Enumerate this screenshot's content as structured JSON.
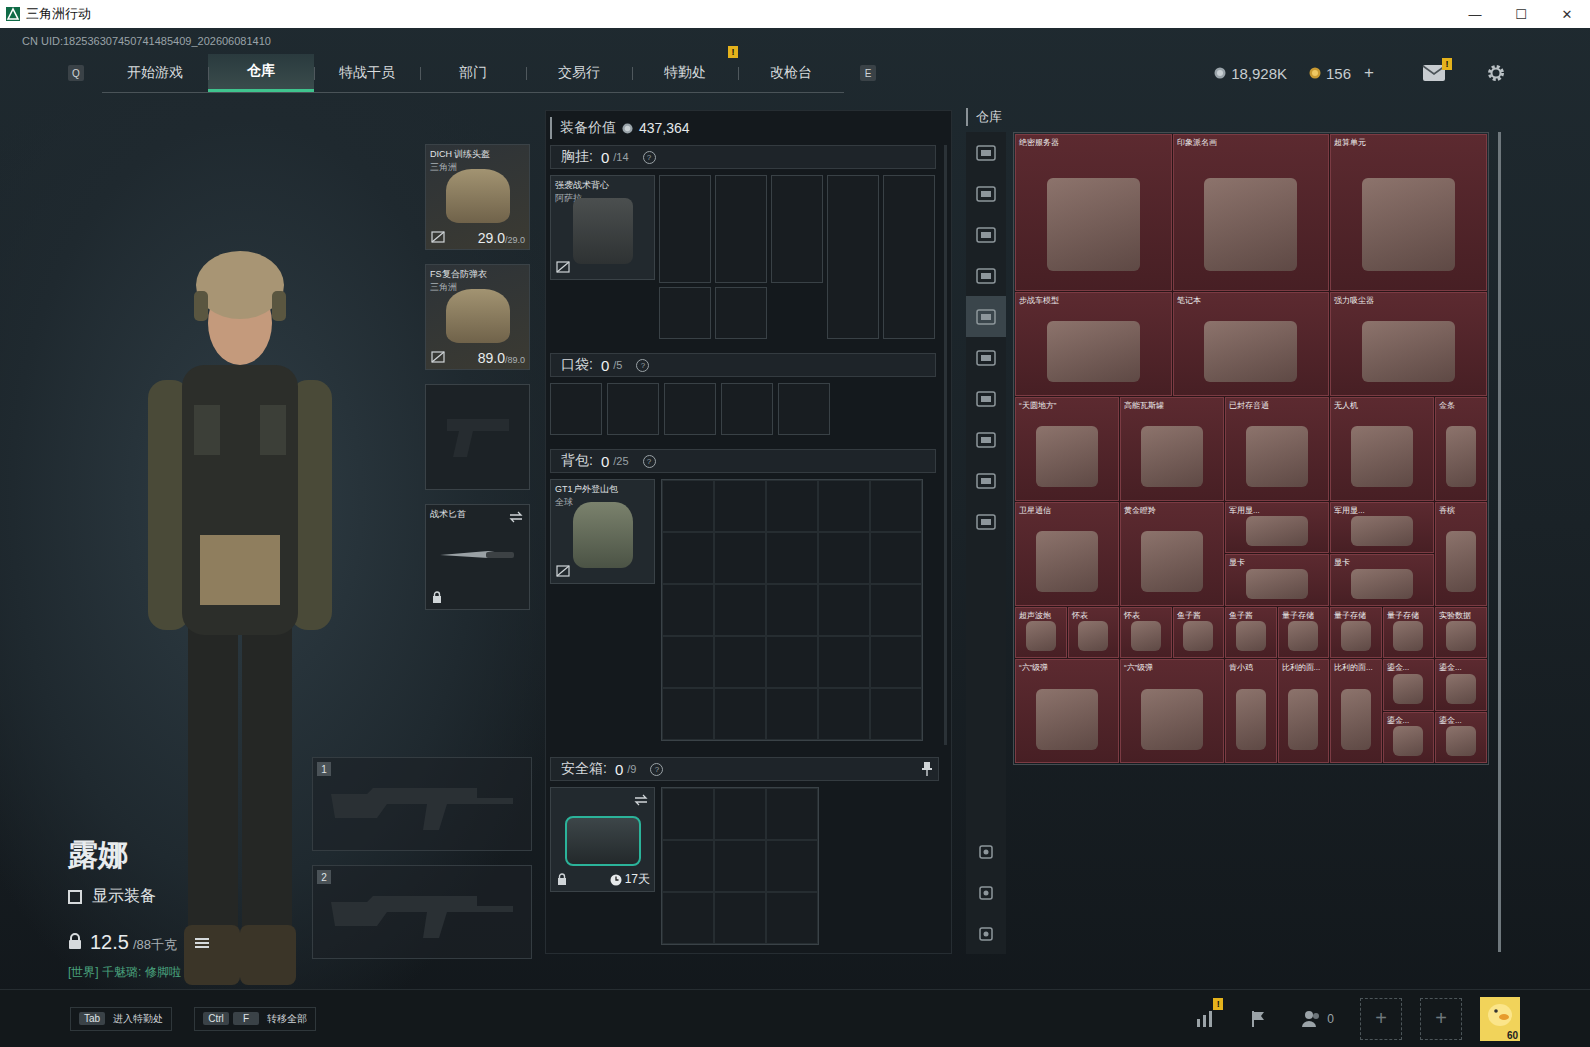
{
  "window": {
    "title": "三角洲行动",
    "controls": [
      "—",
      "☐",
      "✕"
    ]
  },
  "uid": "CN UID:182536307450741485409_202606081410",
  "nav": {
    "prev_key": "Q",
    "next_key": "E",
    "tabs": [
      {
        "label": "开始游戏",
        "selected": false,
        "badge": ""
      },
      {
        "label": "仓库",
        "selected": true,
        "badge": ""
      },
      {
        "label": "特战干员",
        "selected": false,
        "badge": ""
      },
      {
        "label": "部门",
        "selected": false,
        "badge": ""
      },
      {
        "label": "交易行",
        "selected": false,
        "badge": ""
      },
      {
        "label": "特勤处",
        "selected": false,
        "badge": "!"
      },
      {
        "label": "改枪台",
        "selected": false,
        "badge": ""
      }
    ]
  },
  "currency": {
    "money": "18,928K",
    "coupons": "156",
    "add": "+",
    "mail_badge": "!"
  },
  "character": {
    "name": "露娜",
    "show_gear": {
      "label": "显示装备",
      "checked": false
    },
    "weight": "12.5",
    "weight_max": "/88千克",
    "chat": "[世界] 千魅璐: 修脚啦"
  },
  "gear_slots": [
    {
      "kind": "equipped",
      "name": "DICH 训练头盔",
      "sub": "三角洲",
      "durability": "29.0",
      "max": "/29.0",
      "insured": false,
      "locked": false,
      "swappable": false
    },
    {
      "kind": "equipped",
      "name": "FS复合防弹衣",
      "sub": "三角洲",
      "durability": "89.0",
      "max": "/89.0",
      "insured": false,
      "locked": false,
      "swappable": false
    },
    {
      "kind": "empty",
      "name": "",
      "sub": "",
      "durability": "",
      "max": "",
      "insured": true,
      "locked": false,
      "swappable": false
    },
    {
      "kind": "melee",
      "name": "战术匕首",
      "sub": "",
      "durability": "",
      "max": "",
      "insured": true,
      "locked": true,
      "swappable": true
    }
  ],
  "weapon_slots": [
    {
      "number": "1"
    },
    {
      "number": "2"
    }
  ],
  "loadout": {
    "value_label": "装备价值",
    "value": "437,364",
    "chest": {
      "title": "胸挂:",
      "count": "0",
      "cap": "/14",
      "help": "?",
      "item": {
        "name": "强袭战术背心",
        "sub": "阿萨拉",
        "insured": false
      }
    },
    "pockets": {
      "title": "口袋:",
      "count": "0",
      "cap": "/5",
      "help": "?"
    },
    "backpack": {
      "title": "背包:",
      "count": "0",
      "cap": "/25",
      "help": "?",
      "item": {
        "name": "GT1户外登山包",
        "sub": "全球",
        "insured": false
      }
    },
    "safe_box": {
      "title": "安全箱:",
      "count": "0",
      "cap": "/9",
      "help": "?",
      "item": {
        "timer": "17天",
        "locked": true,
        "swappable": true
      }
    }
  },
  "warehouse": {
    "title": "仓库",
    "nav_top": [
      {
        "selected": false
      },
      {
        "selected": false
      },
      {
        "selected": false
      },
      {
        "selected": false
      },
      {
        "selected": true
      },
      {
        "selected": false
      },
      {
        "selected": false
      },
      {
        "selected": false
      },
      {
        "selected": false
      },
      {
        "selected": false
      }
    ],
    "nav_bottom": [
      {
        "selected": false
      },
      {
        "selected": false
      },
      {
        "selected": false
      }
    ],
    "items": [
      {
        "name": "绝密服务器"
      },
      {
        "name": "印象派名画"
      },
      {
        "name": "超算单元"
      },
      {
        "name": "步战车模型"
      },
      {
        "name": "笔记本"
      },
      {
        "name": "强力吸尘器"
      },
      {
        "name": "“天圆地方”"
      },
      {
        "name": "高能瓦斯罐"
      },
      {
        "name": "已封存音通"
      },
      {
        "name": "无人机"
      },
      {
        "name": "金条"
      },
      {
        "name": "卫星通信"
      },
      {
        "name": "黄金瞪羚"
      },
      {
        "name": "军用显..."
      },
      {
        "name": "军用显..."
      },
      {
        "name": "香槟"
      },
      {
        "name": "显卡"
      },
      {
        "name": "显卡"
      },
      {
        "name": "超声波炮"
      },
      {
        "name": "怀表"
      },
      {
        "name": "怀表"
      },
      {
        "name": "鱼子酱"
      },
      {
        "name": "鱼子酱"
      },
      {
        "name": "量子存储"
      },
      {
        "name": "量子存储"
      },
      {
        "name": "量子存储"
      },
      {
        "name": "实验数据"
      },
      {
        "name": "“六”级弹"
      },
      {
        "name": "“六”级弹"
      },
      {
        "name": "肯小鸡"
      },
      {
        "name": "比利的面..."
      },
      {
        "name": "比利的面..."
      },
      {
        "name": "鎏金..."
      },
      {
        "name": "鎏金..."
      },
      {
        "name": "鎏金..."
      },
      {
        "name": "鎏金..."
      }
    ]
  },
  "bottom_bar": {
    "hints": [
      {
        "keys": [
          "Tab"
        ],
        "label": "进入特勤处"
      },
      {
        "keys": [
          "Ctrl",
          "F"
        ],
        "label": "转移全部"
      }
    ],
    "stats_badge": "!",
    "friends_count": "0",
    "add_slots": [
      "+",
      "+"
    ],
    "level": "60"
  }
}
